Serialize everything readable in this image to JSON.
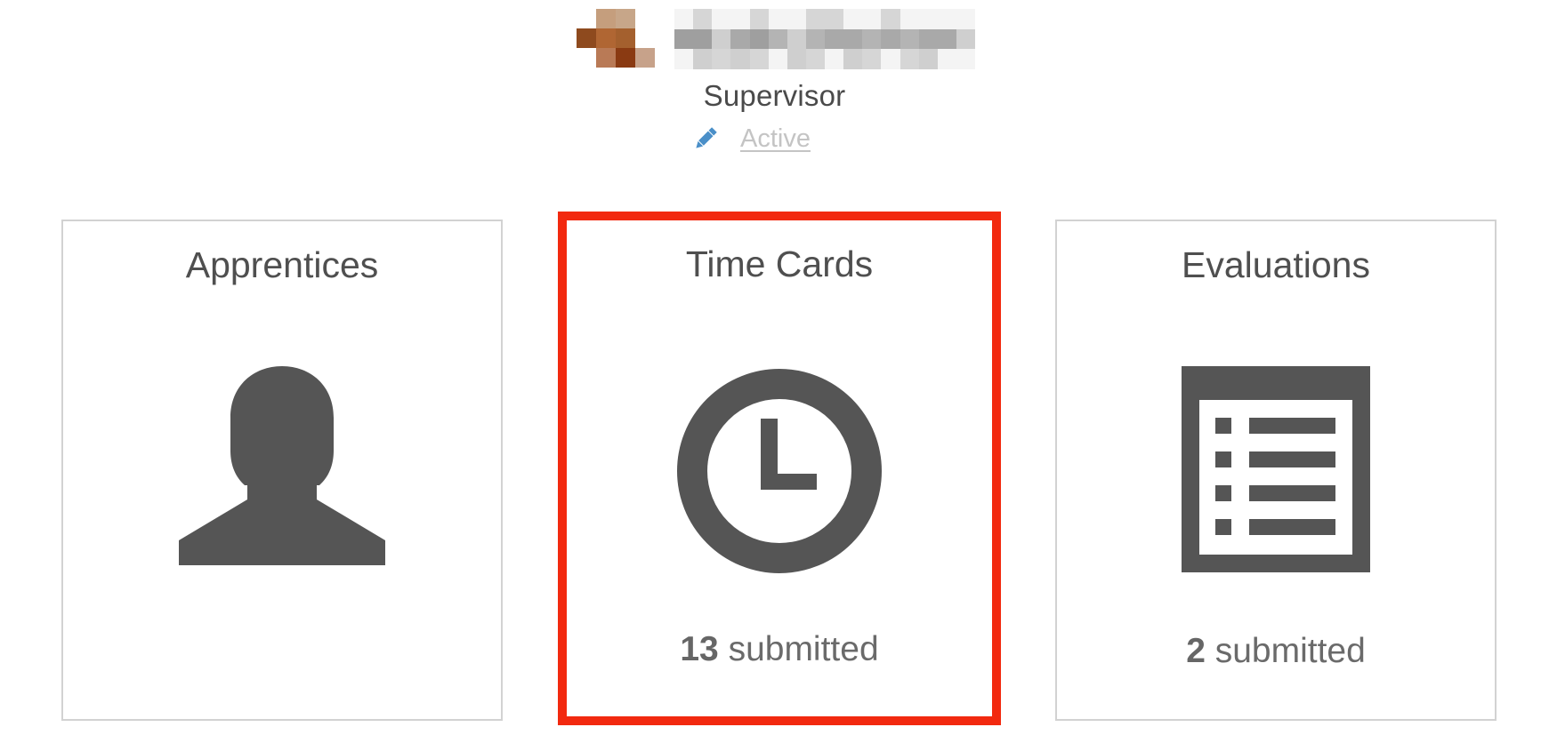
{
  "profile": {
    "avatar_colors": [
      "#ffffff",
      "#c59e7d",
      "#c7a689",
      "#ffffff",
      "#8e4a1e",
      "#b06633",
      "#a4602e",
      "#ffffff",
      "#ffffff",
      "#b97a56",
      "#8a3a12",
      "#c7a28a"
    ],
    "name_redacted": true,
    "role": "Supervisor",
    "status": "Active",
    "edit_icon": "pencil-icon"
  },
  "cards": [
    {
      "key": "apprentices",
      "title": "Apprentices",
      "icon": "person-silhouette-icon",
      "count": "",
      "count_suffix": "",
      "selected": false
    },
    {
      "key": "timecards",
      "title": "Time Cards",
      "icon": "clock-icon",
      "count": "13",
      "count_suffix": " submitted",
      "selected": true
    },
    {
      "key": "evaluations",
      "title": "Evaluations",
      "icon": "list-document-icon",
      "count": "2",
      "count_suffix": " submitted",
      "selected": false
    }
  ],
  "colors": {
    "icon": "#555555",
    "highlight_border": "#f2290f",
    "card_border": "#d2d2d2",
    "link_muted": "#c4c4c4",
    "edit_icon": "#4a8fc8"
  }
}
